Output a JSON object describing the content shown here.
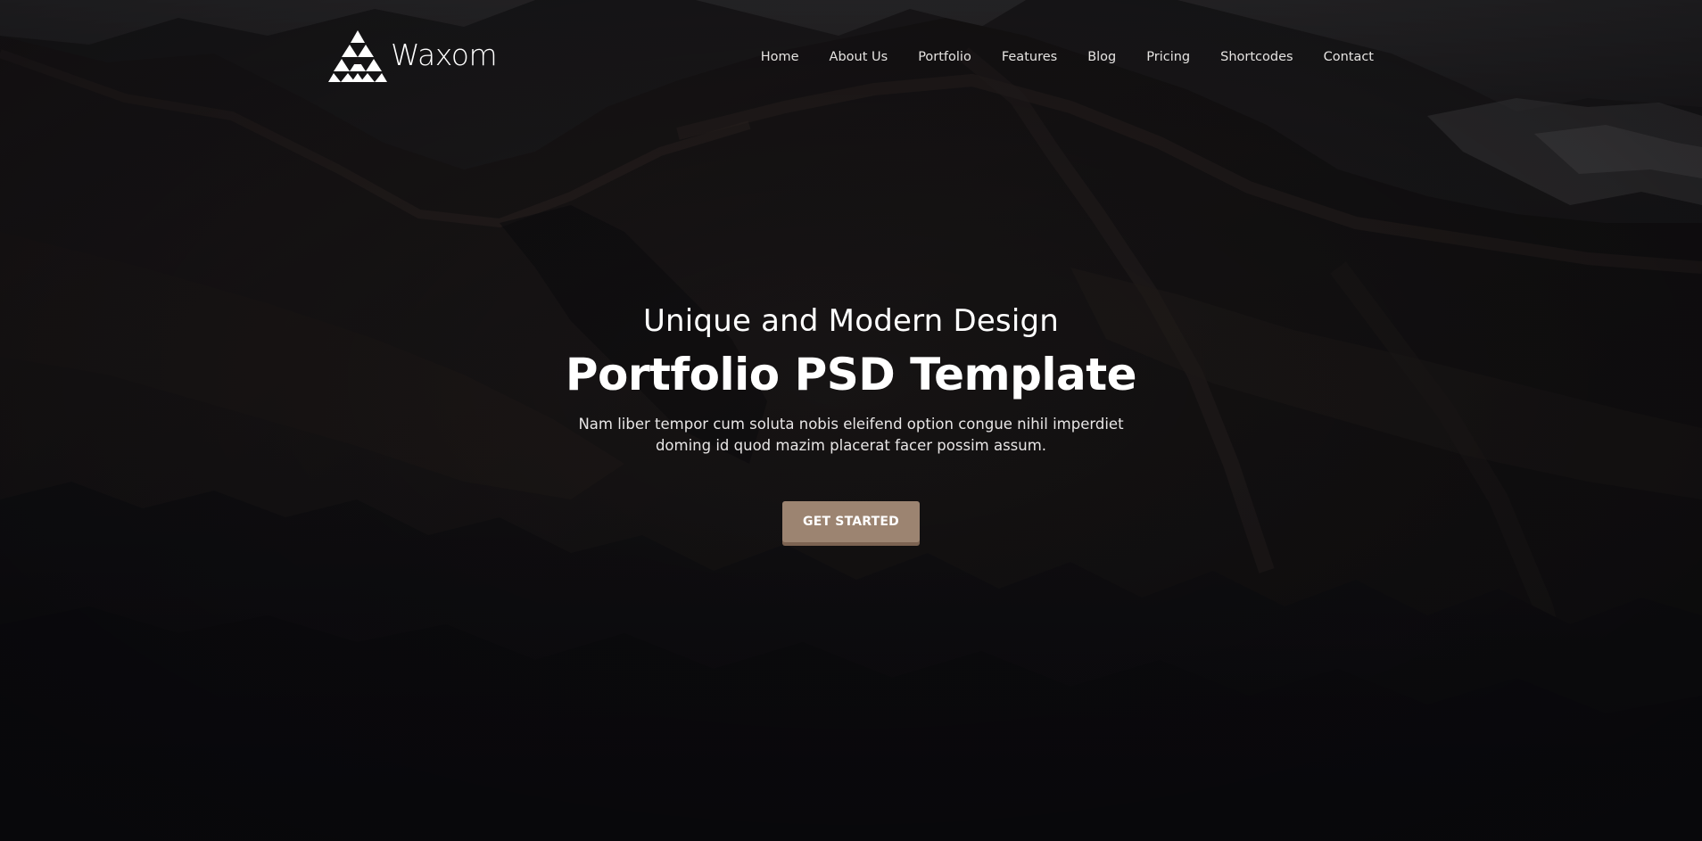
{
  "header": {
    "logo_text": "Waxom",
    "logo_icon": "triangle-logo-icon",
    "nav": [
      {
        "label": "Home"
      },
      {
        "label": "About Us"
      },
      {
        "label": "Portfolio"
      },
      {
        "label": "Features"
      },
      {
        "label": "Blog"
      },
      {
        "label": "Pricing"
      },
      {
        "label": "Shortcodes"
      },
      {
        "label": "Contact"
      }
    ]
  },
  "hero": {
    "subtitle": "Unique and Modern Design",
    "title": "Portfolio PSD Template",
    "description": "Nam liber tempor cum soluta nobis eleifend option congue nihil imperdiet doming id quod mazim placerat facer possim assum.",
    "cta_label": "GET STARTED",
    "background": "dark-mountain-landscape-photo"
  },
  "colors": {
    "accent": "#9c8471",
    "accent_shadow": "#7c6352",
    "text": "#ffffff",
    "overlay": "#0f0e10"
  }
}
